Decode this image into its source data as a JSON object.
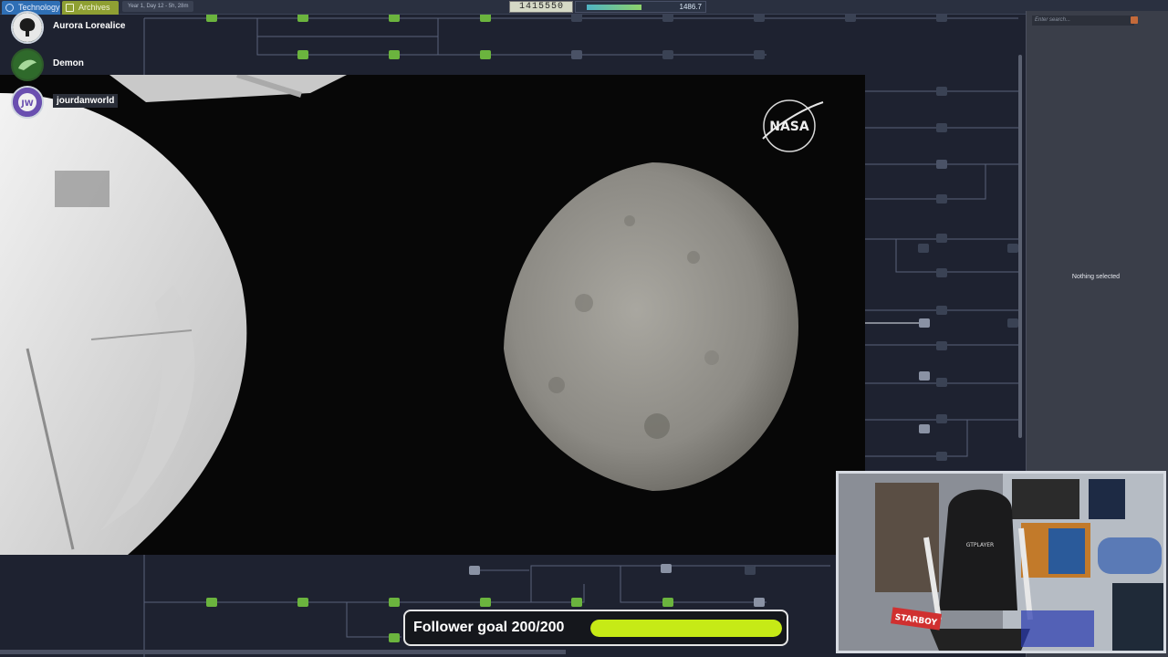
{
  "topbar": {
    "tabs": [
      {
        "label": "Technology",
        "icon": "gear-icon"
      },
      {
        "label": "Archives",
        "icon": "archive-icon"
      }
    ],
    "date": "Year 1, Day 12 - 5h, 28m",
    "counter": "1415550",
    "value": "1486.7"
  },
  "followers": [
    {
      "name": "Aurora Lorealice",
      "avatar": "tree-avatar"
    },
    {
      "name": "Demon",
      "avatar": "dragon-avatar"
    },
    {
      "name": "jourdanworld",
      "avatar": "jw-avatar"
    }
  ],
  "video": {
    "logo": "NASA"
  },
  "right_panel": {
    "search_placeholder": "Enter search...",
    "empty_text": "Nothing selected"
  },
  "webcam": {
    "chair_brand": "GTPLAYER",
    "sign": "STARBOY"
  },
  "goal": {
    "label": "Follower goal 200/200",
    "progress": 1.0,
    "fill_color": "#c6ea16"
  }
}
